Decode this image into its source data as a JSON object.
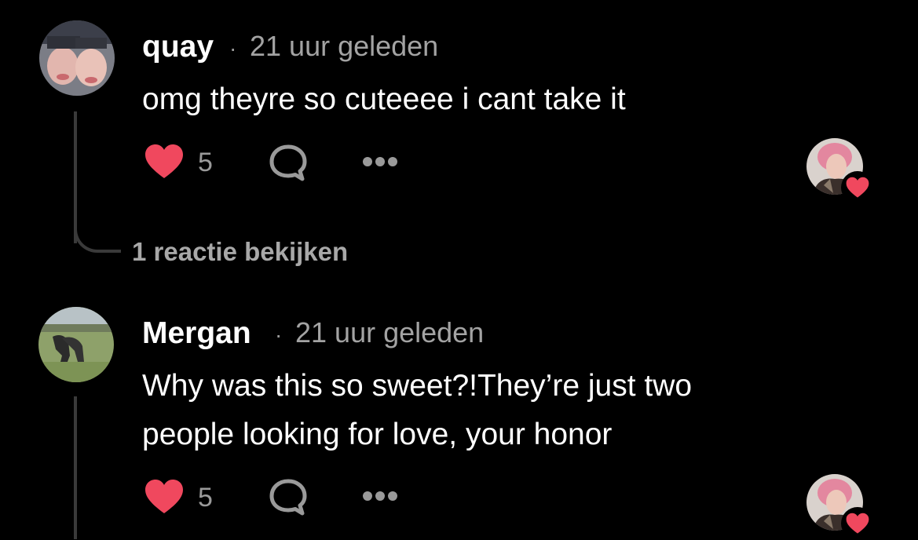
{
  "comments": [
    {
      "username": "quay",
      "separator": "·",
      "time": "21 uur geleden",
      "text_lines": [
        "omg theyre so cuteeee i cant take it"
      ],
      "likes": "5",
      "view_replies": "1 reactie bekijken"
    },
    {
      "username": "Mergan",
      "separator": "·",
      "time": "21 uur geleden",
      "text_lines": [
        "Why was this so sweet?!They’re just two",
        "people looking for love, your honor"
      ],
      "likes": "5"
    }
  ],
  "colors": {
    "background": "#000000",
    "heart": "#f0485e",
    "meta_text": "#a3a3a3",
    "thread_line": "#3a3a3a"
  },
  "icons": {
    "like": "heart-icon",
    "reply": "speech-bubble-icon",
    "more": "ellipsis-icon",
    "creator_liked": "creator-heart-badge-icon"
  }
}
